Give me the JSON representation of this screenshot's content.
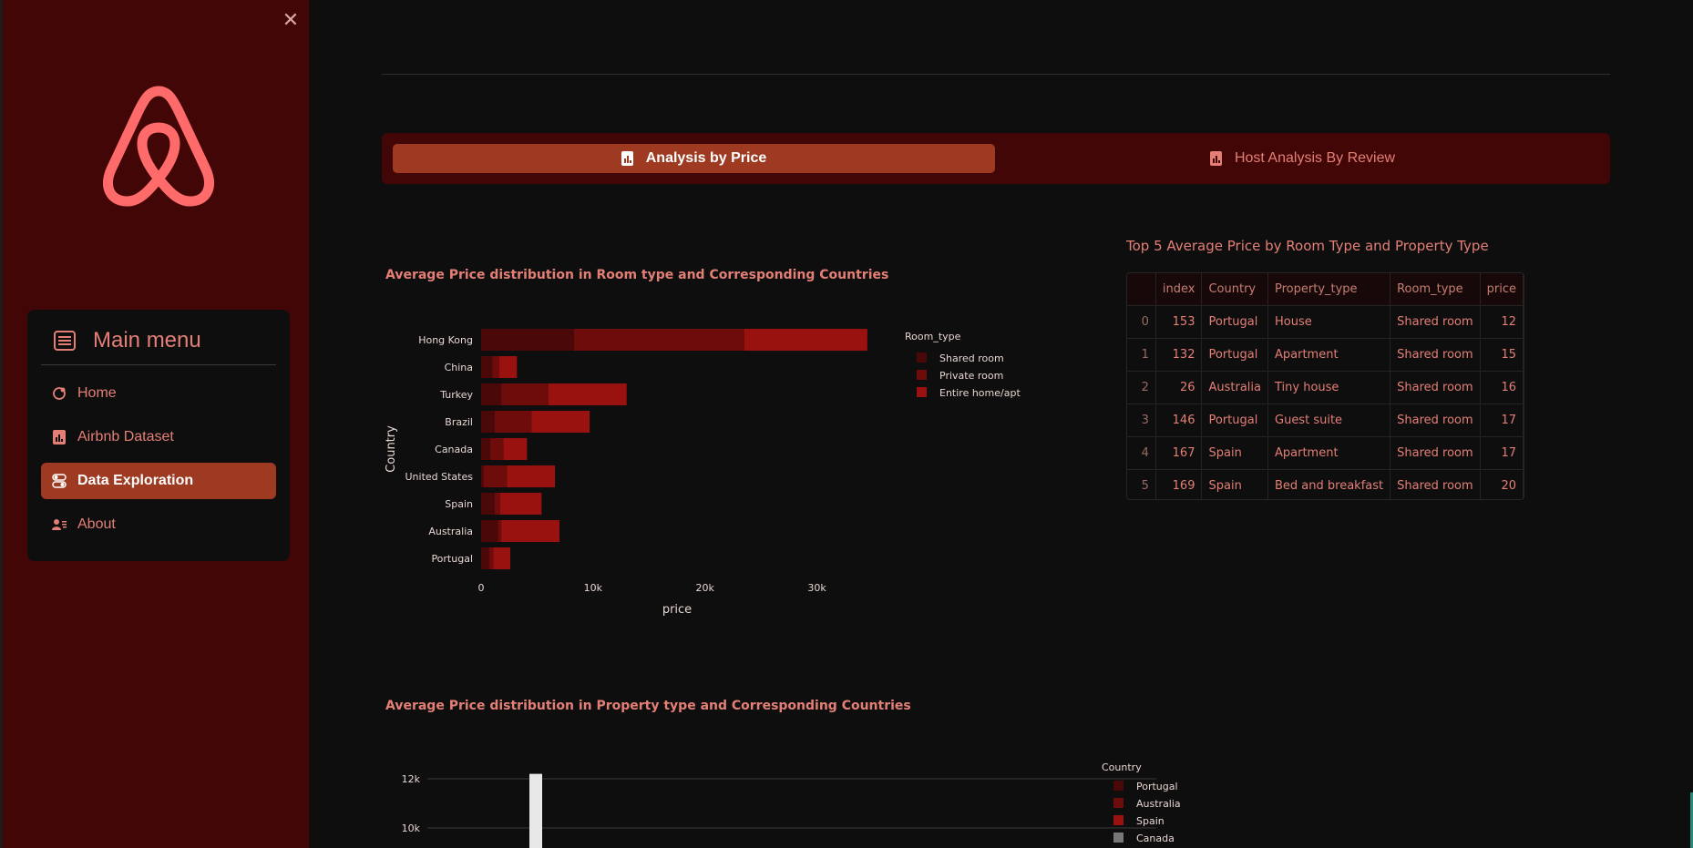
{
  "sidebar": {
    "close_icon": "close-icon",
    "logo_icon": "airbnb-logo-icon",
    "menu_title": "Main menu",
    "menu_title_icon": "menu-list-icon",
    "items": [
      {
        "label": "Home",
        "icon": "house-icon",
        "active": false
      },
      {
        "label": "Airbnb Dataset",
        "icon": "bar-chart-icon",
        "active": false
      },
      {
        "label": "Data Exploration",
        "icon": "toggles-icon",
        "active": true
      },
      {
        "label": "About",
        "icon": "person-lines-icon",
        "active": false
      }
    ]
  },
  "tabs": [
    {
      "label": "Analysis by Price",
      "icon": "bar-chart-icon",
      "active": true
    },
    {
      "label": "Host Analysis By Review",
      "icon": "bar-chart-icon",
      "active": false
    }
  ],
  "chart1": {
    "title": "Average Price distribution in Room type and Corresponding Countries"
  },
  "chart2": {
    "title": "Average Price distribution in Property type and Corresponding Countries"
  },
  "table": {
    "title": "Top 5 Average Price by Room Type and Property Type",
    "columns": [
      "",
      "index",
      "Country",
      "Property_type",
      "Room_type",
      "price"
    ],
    "rows": [
      [
        "0",
        "153",
        "Portugal",
        "House",
        "Shared room",
        "12"
      ],
      [
        "1",
        "132",
        "Portugal",
        "Apartment",
        "Shared room",
        "15"
      ],
      [
        "2",
        "26",
        "Australia",
        "Tiny house",
        "Shared room",
        "16"
      ],
      [
        "3",
        "146",
        "Portugal",
        "Guest suite",
        "Shared room",
        "17"
      ],
      [
        "4",
        "167",
        "Spain",
        "Apartment",
        "Shared room",
        "17"
      ],
      [
        "5",
        "169",
        "Spain",
        "Bed and breakfast",
        "Shared room",
        "20"
      ]
    ]
  },
  "colors": {
    "accent": "#9e3a22",
    "sidebar_bg": "#430606",
    "text_accent": "#e47f76",
    "shared_room": "#4a0808",
    "private_room": "#6e0b0b",
    "entire_home": "#9a1210",
    "canada": "#777777"
  },
  "chart_data": [
    {
      "type": "bar",
      "orientation": "horizontal",
      "stacked": true,
      "ylabel": "Country",
      "xlabel": "price",
      "categories": [
        "Hong Kong",
        "China",
        "Turkey",
        "Brazil",
        "Canada",
        "United States",
        "Spain",
        "Australia",
        "Portugal"
      ],
      "series": [
        {
          "name": "Shared room",
          "values": [
            8300,
            1000,
            1800,
            1200,
            800,
            200,
            1200,
            1500,
            700
          ]
        },
        {
          "name": "Private room",
          "values": [
            15200,
            600,
            4200,
            3300,
            1200,
            2100,
            500,
            300,
            400
          ]
        },
        {
          "name": "Entire home/apt",
          "values": [
            11000,
            1600,
            7000,
            5200,
            2100,
            4300,
            3700,
            5200,
            1500
          ]
        }
      ],
      "legend_title": "Room_type",
      "legend_position": "right",
      "xticks": [
        "0",
        "10k",
        "20k",
        "30k"
      ],
      "xlim": [
        0,
        35000
      ]
    },
    {
      "type": "bar",
      "stacked": true,
      "legend_title": "Country",
      "legend_position": "right",
      "series": [
        {
          "name": "Portugal"
        },
        {
          "name": "Australia"
        },
        {
          "name": "Spain"
        },
        {
          "name": "Canada"
        }
      ],
      "yticks": [
        "10k",
        "12k"
      ],
      "visible_bars": [
        {
          "series": "Canada",
          "value_min": 12200
        }
      ],
      "ylim_visible": [
        9500,
        12300
      ]
    }
  ]
}
